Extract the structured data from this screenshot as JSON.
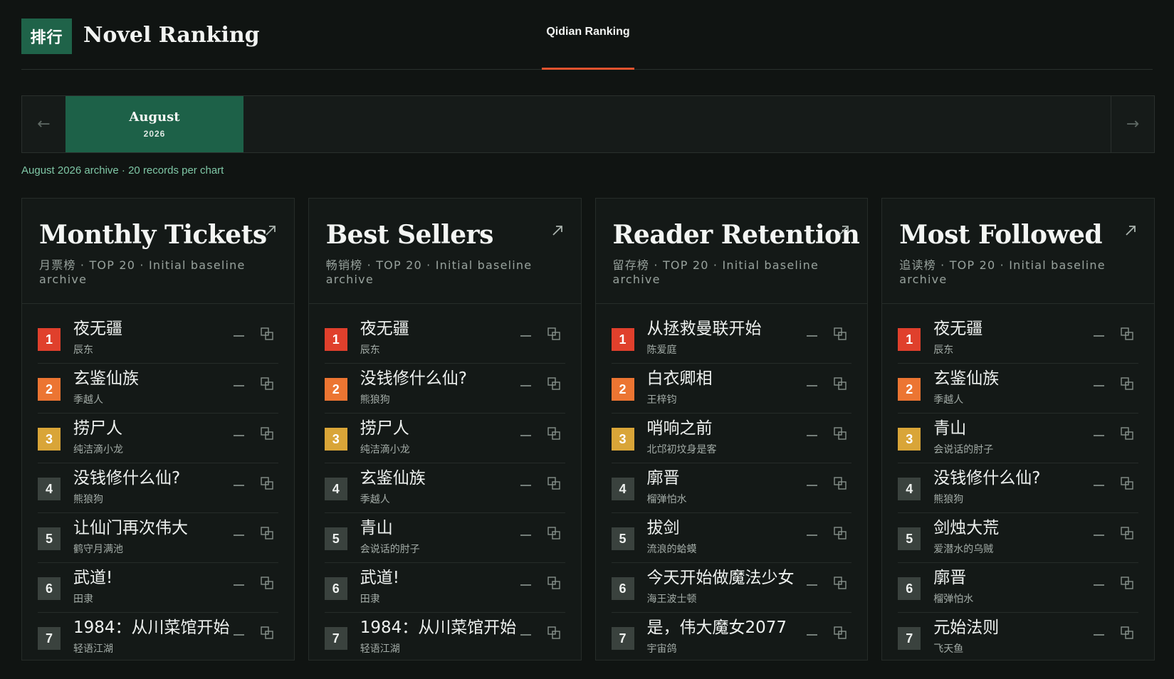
{
  "header": {
    "logo_text": "排行",
    "title": "Novel Ranking",
    "nav_tab": "Qidian Ranking"
  },
  "month_bar": {
    "prev_icon": "arrow-left-icon",
    "next_icon": "arrow-right-icon",
    "month": "August",
    "year": "2026"
  },
  "archive_note": "August 2026 archive · 20 records per chart",
  "colors": {
    "brand_green": "#1f6349",
    "accent_red": "#e2532f",
    "rank1": "#e0402c",
    "rank2": "#ec7532",
    "rank3": "#d9a538"
  },
  "cards": [
    {
      "title": "Monthly Tickets",
      "subtitle": "月票榜 · TOP 20 · Initial baseline archive",
      "items": [
        {
          "rank": "1",
          "title": "夜无疆",
          "author": "辰东"
        },
        {
          "rank": "2",
          "title": "玄鉴仙族",
          "author": "季越人"
        },
        {
          "rank": "3",
          "title": "捞尸人",
          "author": "纯洁滴小龙"
        },
        {
          "rank": "4",
          "title": "没钱修什么仙?",
          "author": "熊狼狗"
        },
        {
          "rank": "5",
          "title": "让仙门再次伟大",
          "author": "鹤守月满池"
        },
        {
          "rank": "6",
          "title": "武道!",
          "author": "田隶"
        },
        {
          "rank": "7",
          "title": "1984：从川菜馆开始",
          "author": "轻语江湖"
        }
      ]
    },
    {
      "title": "Best Sellers",
      "subtitle": "畅销榜 · TOP 20 · Initial baseline archive",
      "items": [
        {
          "rank": "1",
          "title": "夜无疆",
          "author": "辰东"
        },
        {
          "rank": "2",
          "title": "没钱修什么仙?",
          "author": "熊狼狗"
        },
        {
          "rank": "3",
          "title": "捞尸人",
          "author": "纯洁滴小龙"
        },
        {
          "rank": "4",
          "title": "玄鉴仙族",
          "author": "季越人"
        },
        {
          "rank": "5",
          "title": "青山",
          "author": "会说话的肘子"
        },
        {
          "rank": "6",
          "title": "武道!",
          "author": "田隶"
        },
        {
          "rank": "7",
          "title": "1984：从川菜馆开始",
          "author": "轻语江湖"
        }
      ]
    },
    {
      "title": "Reader Retention",
      "subtitle": "留存榜 · TOP 20 · Initial baseline archive",
      "items": [
        {
          "rank": "1",
          "title": "从拯救曼联开始",
          "author": "陈爱庭"
        },
        {
          "rank": "2",
          "title": "白衣卿相",
          "author": "王梓钧"
        },
        {
          "rank": "3",
          "title": "哨响之前",
          "author": "北邙初坟身是客"
        },
        {
          "rank": "4",
          "title": "廓晋",
          "author": "榴弹怕水"
        },
        {
          "rank": "5",
          "title": "拔剑",
          "author": "流浪的蛤蟆"
        },
        {
          "rank": "6",
          "title": "今天开始做魔法少女",
          "author": "海王波士顿"
        },
        {
          "rank": "7",
          "title": "是，伟大魔女2077",
          "author": "宇宙鸽"
        }
      ]
    },
    {
      "title": "Most Followed",
      "subtitle": "追读榜 · TOP 20 · Initial baseline archive",
      "items": [
        {
          "rank": "1",
          "title": "夜无疆",
          "author": "辰东"
        },
        {
          "rank": "2",
          "title": "玄鉴仙族",
          "author": "季越人"
        },
        {
          "rank": "3",
          "title": "青山",
          "author": "会说话的肘子"
        },
        {
          "rank": "4",
          "title": "没钱修什么仙?",
          "author": "熊狼狗"
        },
        {
          "rank": "5",
          "title": "剑烛大荒",
          "author": "爱潜水的乌贼"
        },
        {
          "rank": "6",
          "title": "廓晋",
          "author": "榴弹怕水"
        },
        {
          "rank": "7",
          "title": "元始法则",
          "author": "飞天鱼"
        }
      ]
    }
  ]
}
